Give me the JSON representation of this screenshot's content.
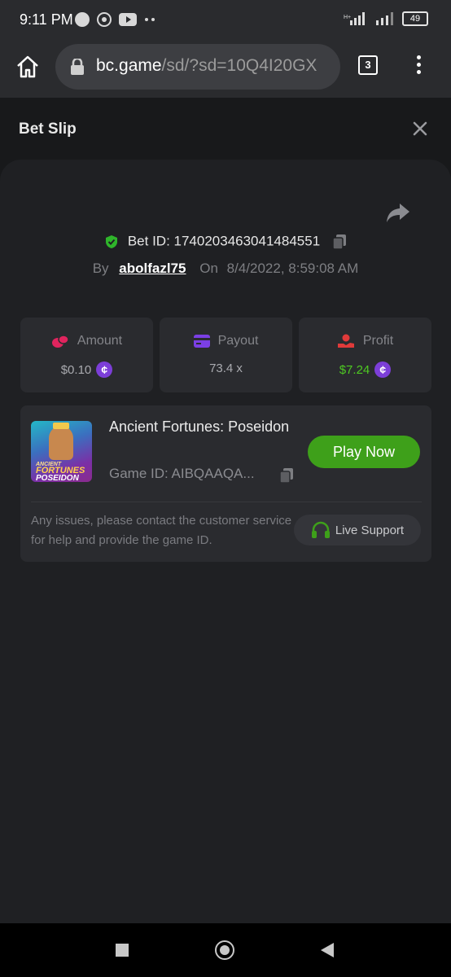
{
  "status_bar": {
    "time": "9:11 PM",
    "battery": "49"
  },
  "browser": {
    "url_host": "bc.game",
    "url_path": "/sd/?sd=10Q4I20GX",
    "tab_count": "3"
  },
  "panel": {
    "title": "Bet Slip"
  },
  "bet": {
    "id_text": "Bet ID: 1740203463041484551",
    "by_label": "By",
    "username": "abolfazl75",
    "on_label": "On",
    "datetime": "8/4/2022, 8:59:08 AM"
  },
  "stats": [
    {
      "label": "Amount",
      "value": "$0.10",
      "icon": "coins-icon",
      "color": "#e0245e"
    },
    {
      "label": "Payout",
      "value": "73.4 x",
      "icon": "card-icon",
      "color": "#7b3fe4"
    },
    {
      "label": "Profit",
      "value": "$7.24",
      "icon": "hand-coin-icon",
      "color": "#e03a3a"
    }
  ],
  "game": {
    "title": "Ancient Fortunes: Poseidon",
    "id_text": "Game ID: AIBQAAQA...",
    "play_label": "Play Now",
    "thumb_line1": "ANCIENT",
    "thumb_line2": "FORTUNES",
    "thumb_line3": "POSEIDON"
  },
  "help": {
    "text": "Any issues, please contact the customer service for help and provide the game ID.",
    "support_label": "Live Support"
  },
  "colors": {
    "accent_green": "#3ea01a",
    "coin_purple": "#7c3ed8",
    "profit_green": "#4ec922"
  }
}
